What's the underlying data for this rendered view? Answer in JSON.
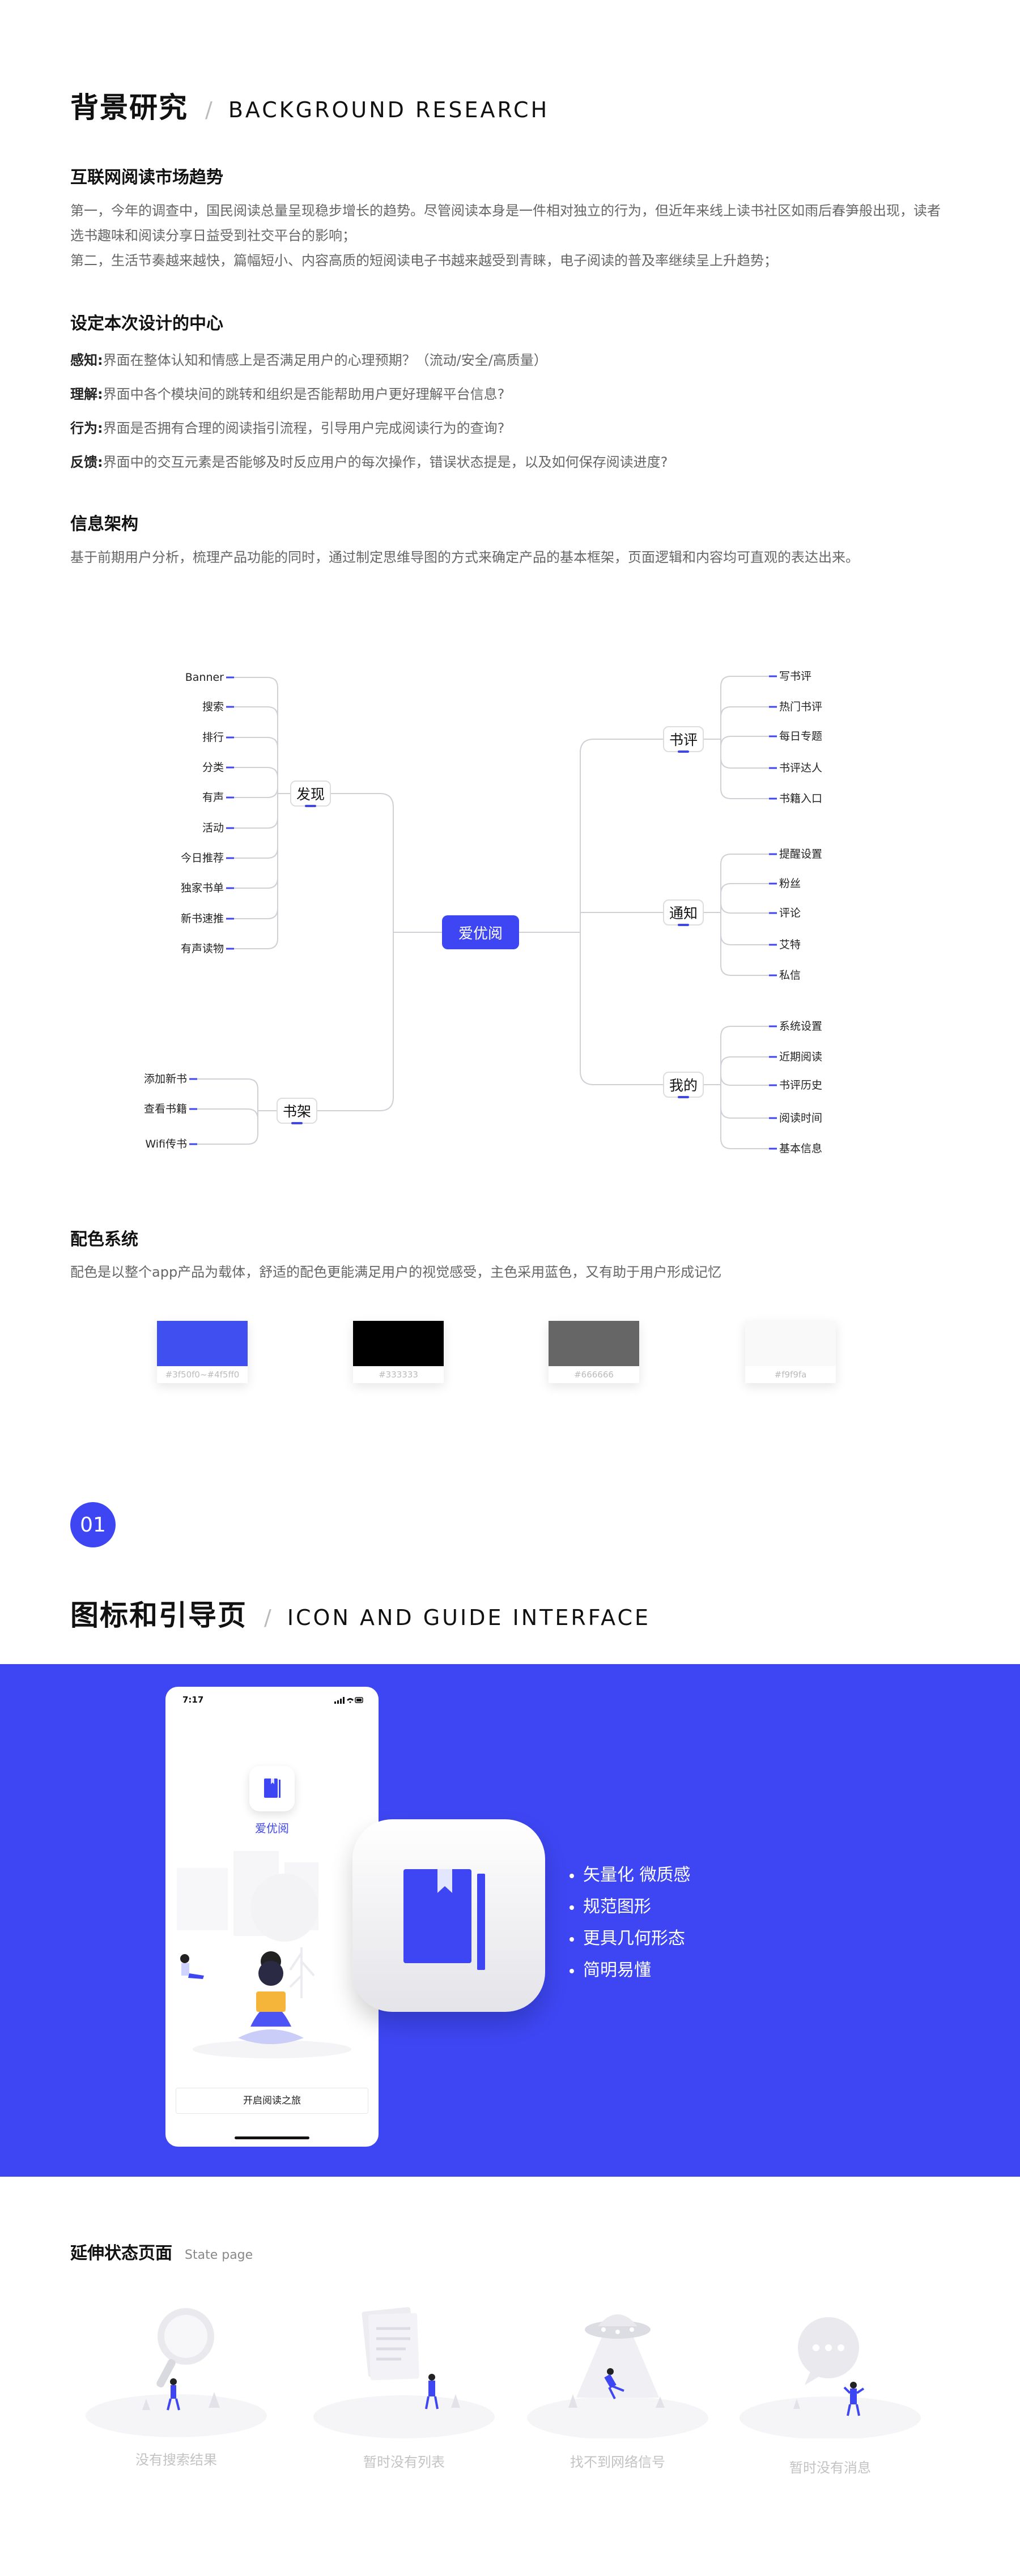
{
  "background": {
    "title_zh": "背景研究",
    "title_en": "BACKGROUND RESEARCH",
    "trend": {
      "title": "互联网阅读市场趋势",
      "lines": [
        "第一，今年的调查中，国民阅读总量呈现稳步增长的趋势。尽管阅读本身是一件相对独立的行为，但近年来线上读书社区如雨后春笋般出现，读者",
        "选书趣味和阅读分享日益受到社交平台的影响；",
        "第二，生活节奏越来越快，篇幅短小、内容高质的短阅读电子书越来越受到青睐，电子阅读的普及率继续呈上升趋势；"
      ]
    },
    "design_center": {
      "title": "设定本次设计的中心",
      "items": [
        {
          "label": "感知:",
          "text": "界面在整体认知和情感上是否满足用户的心理预期？（流动/安全/高质量）"
        },
        {
          "label": "理解:",
          "text": "界面中各个模块间的跳转和组织是否能帮助用户更好理解平台信息?"
        },
        {
          "label": "行为:",
          "text": "界面是否拥有合理的阅读指引流程，引导用户完成阅读行为的查询?"
        },
        {
          "label": "反馈:",
          "text": "界面中的交互元素是否能够及时反应用户的每次操作，错误状态提是，以及如何保存阅读进度?"
        }
      ]
    },
    "info_arch": {
      "title": "信息架构",
      "text": "基于前期用户分析，梳理产品功能的同时，通过制定思维导图的方式来确定产品的基本框架，页面逻辑和内容均可直观的表达出来。"
    }
  },
  "mindmap": {
    "root": "爱优阅",
    "discover": {
      "label": "发现",
      "children": [
        "Banner",
        "搜索",
        "排行",
        "分类",
        "有声",
        "活动",
        "今日推荐",
        "独家书单",
        "新书速推",
        "有声读物"
      ]
    },
    "shelf": {
      "label": "书架",
      "children": [
        "添加新书",
        "查看书籍",
        "Wifi传书"
      ]
    },
    "review": {
      "label": "书评",
      "children": [
        "写书评",
        "热门书评",
        "每日专题",
        "书评达人",
        "书籍入口"
      ]
    },
    "notice": {
      "label": "通知",
      "children": [
        "提醒设置",
        "粉丝",
        "评论",
        "艾特",
        "私信"
      ]
    },
    "mine": {
      "label": "我的",
      "children": [
        "系统设置",
        "近期阅读",
        "书评历史",
        "阅读时间",
        "基本信息"
      ]
    }
  },
  "colors": {
    "title": "配色系统",
    "text": "配色是以整个app产品为载体，舒适的配色更能满足用户的视觉感受，主色采用蓝色，又有助于用户形成记忆",
    "swatches": [
      {
        "label": "#3f50f0~#4f5ff0",
        "hex": "#3f4ff0"
      },
      {
        "label": "#333333",
        "hex": "#000000"
      },
      {
        "label": "#666666",
        "hex": "#666666"
      },
      {
        "label": "#f9f9fa",
        "hex": "#f9f9fa"
      }
    ]
  },
  "guide": {
    "badge": "01",
    "title_zh": "图标和引导页",
    "title_en": "ICON AND GUIDE INTERFACE",
    "band_color": "#3d46f2",
    "phone": {
      "time": "7:17",
      "app_name": "爱优阅",
      "start_button": "开启阅读之旅"
    },
    "features": [
      "矢量化 微质感",
      "规范图形",
      "更具几何形态",
      "简明易懂"
    ]
  },
  "states": {
    "title_zh": "延伸状态页面",
    "title_en": "State page",
    "items": [
      {
        "caption": "没有搜索结果",
        "icon": "magnifier-illustration"
      },
      {
        "caption": "暂时没有列表",
        "icon": "document-illustration"
      },
      {
        "caption": "找不到网络信号",
        "icon": "ufo-illustration"
      },
      {
        "caption": "暂时没有消息",
        "icon": "chat-bubble-illustration"
      }
    ]
  }
}
